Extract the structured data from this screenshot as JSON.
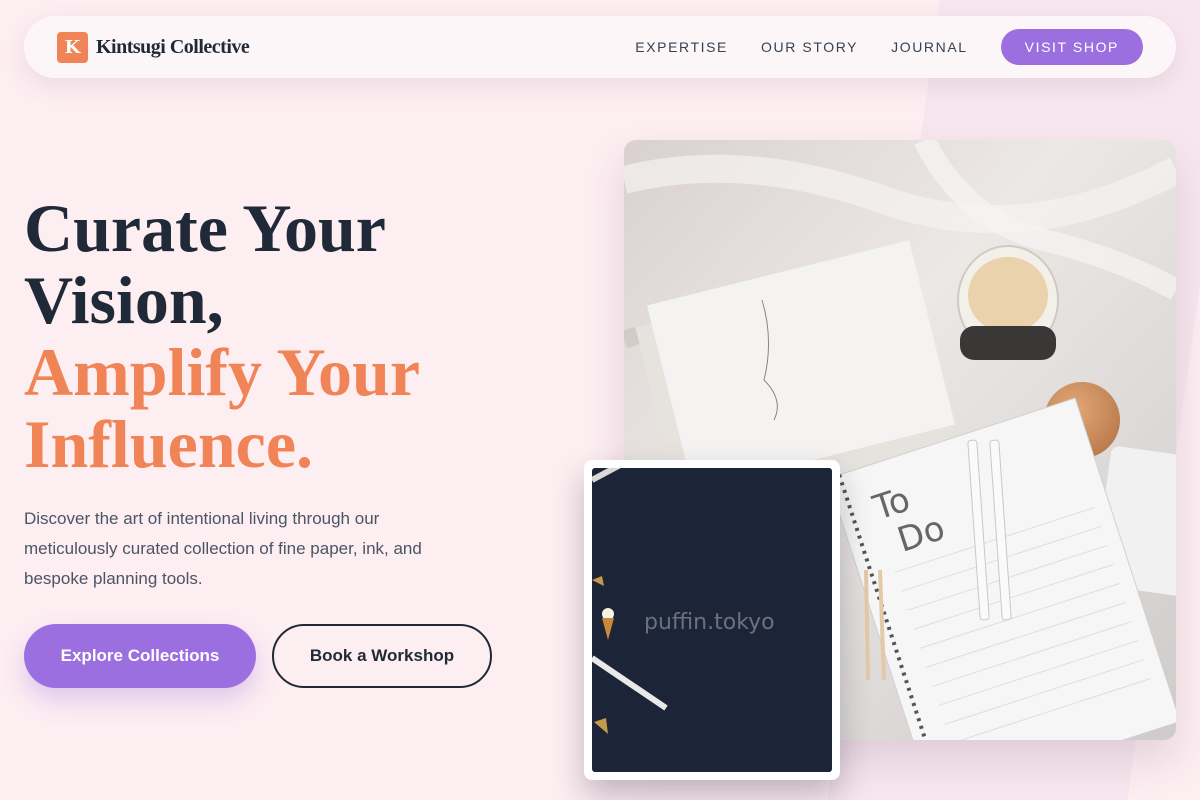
{
  "nav": {
    "logo_letter": "K",
    "brand": "Kintsugi Collective",
    "links": [
      "EXPERTISE",
      "OUR STORY",
      "JOURNAL"
    ],
    "cta": "VISIT SHOP"
  },
  "hero": {
    "headline_dark_1": "Curate Your",
    "headline_dark_2": "Vision,",
    "headline_accent_1": "Amplify Your",
    "headline_accent_2": "Influence.",
    "description": "Discover the art of intentional living through our meticulously curated collection of fine paper, ink, and bespoke planning tools.",
    "primary_button": "Explore Collections",
    "secondary_button": "Book a Workshop"
  },
  "images": {
    "main_notebook_text_1": "To",
    "main_notebook_text_2": "Do",
    "secondary_watermark": "puffin.tokyo"
  },
  "colors": {
    "background": "#fdeef2",
    "accent": "#f08457",
    "brand_purple": "#9b6fe0",
    "text_dark": "#1f2937"
  }
}
